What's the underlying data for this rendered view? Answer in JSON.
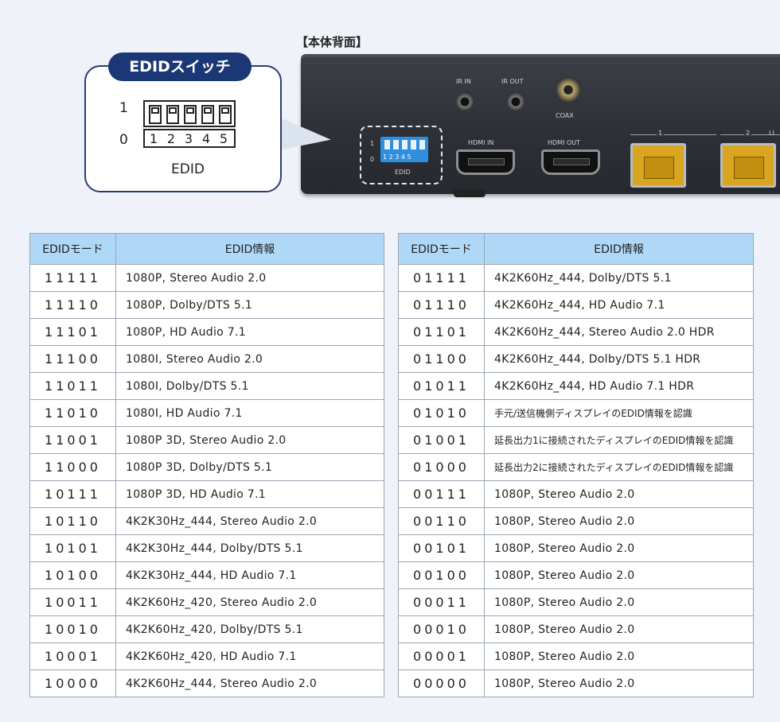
{
  "header": {
    "rear_label": "【本体背面】"
  },
  "callout": {
    "title": "EDIDスイッチ",
    "on_label": "1",
    "off_label": "0",
    "switch_numbers": [
      "1",
      "2",
      "3",
      "4",
      "5"
    ],
    "caption": "EDID"
  },
  "device": {
    "ir_in": "IR IN",
    "ir_out": "IR OUT",
    "coax": "COAX",
    "hdmi_in": "HDMI IN",
    "hdmi_out": "HDMI OUT",
    "dip_label": "EDID",
    "dip_on": "1",
    "dip_off": "0",
    "dip_numbers": "1 2 3 4 5",
    "port1": "1",
    "port2": "2",
    "link": "LI"
  },
  "tables": {
    "headers": {
      "mode": "EDIDモード",
      "info": "EDID情報"
    },
    "left": [
      {
        "mode": "11111",
        "info": "1080P, Stereo Audio 2.0"
      },
      {
        "mode": "11110",
        "info": "1080P, Dolby/DTS 5.1"
      },
      {
        "mode": "11101",
        "info": "1080P, HD Audio 7.1"
      },
      {
        "mode": "11100",
        "info": "1080I, Stereo Audio 2.0"
      },
      {
        "mode": "11011",
        "info": "1080I, Dolby/DTS 5.1"
      },
      {
        "mode": "11010",
        "info": "1080I, HD Audio 7.1"
      },
      {
        "mode": "11001",
        "info": "1080P 3D, Stereo Audio 2.0"
      },
      {
        "mode": "11000",
        "info": "1080P 3D, Dolby/DTS 5.1"
      },
      {
        "mode": "10111",
        "info": "1080P 3D, HD Audio 7.1"
      },
      {
        "mode": "10110",
        "info": "4K2K30Hz_444, Stereo Audio 2.0"
      },
      {
        "mode": "10101",
        "info": "4K2K30Hz_444, Dolby/DTS 5.1"
      },
      {
        "mode": "10100",
        "info": "4K2K30Hz_444, HD Audio 7.1"
      },
      {
        "mode": "10011",
        "info": "4K2K60Hz_420, Stereo Audio 2.0"
      },
      {
        "mode": "10010",
        "info": "4K2K60Hz_420, Dolby/DTS 5.1"
      },
      {
        "mode": "10001",
        "info": "4K2K60Hz_420, HD Audio 7.1"
      },
      {
        "mode": "10000",
        "info": "4K2K60Hz_444, Stereo Audio 2.0"
      }
    ],
    "right": [
      {
        "mode": "01111",
        "info": "4K2K60Hz_444, Dolby/DTS 5.1"
      },
      {
        "mode": "01110",
        "info": "4K2K60Hz_444, HD Audio 7.1"
      },
      {
        "mode": "01101",
        "info": "4K2K60Hz_444, Stereo Audio 2.0 HDR"
      },
      {
        "mode": "01100",
        "info": "4K2K60Hz_444, Dolby/DTS 5.1 HDR"
      },
      {
        "mode": "01011",
        "info": "4K2K60Hz_444, HD Audio 7.1 HDR"
      },
      {
        "mode": "01010",
        "info": "手元/送信機側ディスプレイのEDID情報を認識"
      },
      {
        "mode": "01001",
        "info": "延長出力1に接続されたディスプレイのEDID情報を認識"
      },
      {
        "mode": "01000",
        "info": "延長出力2に接続されたディスプレイのEDID情報を認識"
      },
      {
        "mode": "00111",
        "info": "1080P, Stereo Audio 2.0"
      },
      {
        "mode": "00110",
        "info": "1080P, Stereo Audio 2.0"
      },
      {
        "mode": "00101",
        "info": "1080P, Stereo Audio 2.0"
      },
      {
        "mode": "00100",
        "info": "1080P, Stereo Audio 2.0"
      },
      {
        "mode": "00011",
        "info": "1080P, Stereo Audio 2.0"
      },
      {
        "mode": "00010",
        "info": "1080P, Stereo Audio 2.0"
      },
      {
        "mode": "00001",
        "info": "1080P, Stereo Audio 2.0"
      },
      {
        "mode": "00000",
        "info": "1080P, Stereo Audio 2.0"
      }
    ]
  }
}
